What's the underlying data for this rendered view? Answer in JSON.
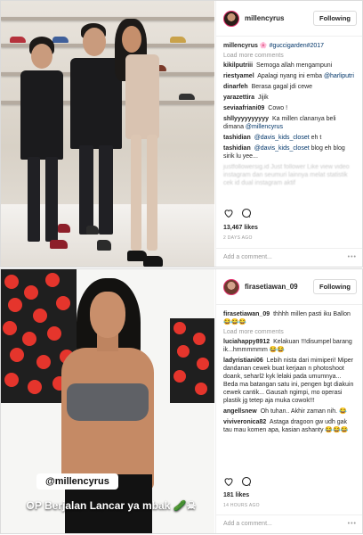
{
  "posts": [
    {
      "username": "millencyrus",
      "follow_label": "Following",
      "caption_user": "millencyrus",
      "caption_text": "🌸 #guccigarden#2017",
      "load_more": "Load more comments",
      "comments": [
        {
          "user": "kikilputriii",
          "text": "Semoga allah mengampuni"
        },
        {
          "user": "riestyamel",
          "text": "Apalagi nyang ini emba",
          "mention": "@harliputri"
        },
        {
          "user": "dinarfeh",
          "text": "Berasa gagal jdi cewe"
        },
        {
          "user": "yarazettira",
          "text": "Jijik"
        },
        {
          "user": "seviaafriani09",
          "text": "Cowo !"
        },
        {
          "user": "shllyyyyyyyyyy",
          "text": "Ka millen clananya beli dimana",
          "mention": "@millencyrus"
        },
        {
          "user": "tashidian",
          "text": "eh t",
          "mention": "@davis_kids_closet"
        },
        {
          "user": "tashidian",
          "text": "blog eh blog sirik lu yee...",
          "mention": "@davis_kids_closet"
        },
        {
          "user": "",
          "text": "justfollowersig.id Just follower Like view video instagram dan seumuri lainnya melat statistik cek id dual instagram aktif"
        }
      ],
      "likes": "13,467 likes",
      "ago": "2 DAYS AGO",
      "add_comment": "Add a comment...",
      "more": "•••"
    },
    {
      "username": "firasetiawan_09",
      "follow_label": "Following",
      "caption_user": "firasetiawan_09",
      "caption_text": "thhhh millen pasti iku Ballon 😂😂😂",
      "load_more": "Load more comments",
      "comments": [
        {
          "user": "luciahappy8912",
          "text": "Kelakuan !!!disumpel barang ik...hmmmmmm 😂😂"
        },
        {
          "user": "ladyristiani06",
          "text": "Lebih nista dari mimiperi! Miper dandanan cewek buat kerjaan n photoshoot doank, seharl2 kyk lelaki pada umumnya... Beda ma batangan satu ini, pengen bgt diakuin cewek cantik... Gausah ngimpi, mo operasi plastik jg tetep aja muka cowok!!!"
        },
        {
          "user": "angellsnew",
          "text": "Oh tuhan.. Akhir zaman nih. 😂"
        },
        {
          "user": "viviveronica82",
          "text": "Astaga dragoon gw udh gak tau mau komen apa, kasian ashanty 😂😂😂"
        }
      ],
      "likes": "181 likes",
      "ago": "14 HOURS AGO",
      "add_comment": "Add a comment...",
      "more": "•••",
      "overlay_tag": "@millencyrus",
      "overlay_caption": "OP Berjalan Lancar ya mbak 🥒☠"
    }
  ],
  "colors": {
    "accent_link": "#003569",
    "muted": "#999999",
    "border": "#dbdbdb",
    "dots_red": "#e5352c"
  }
}
